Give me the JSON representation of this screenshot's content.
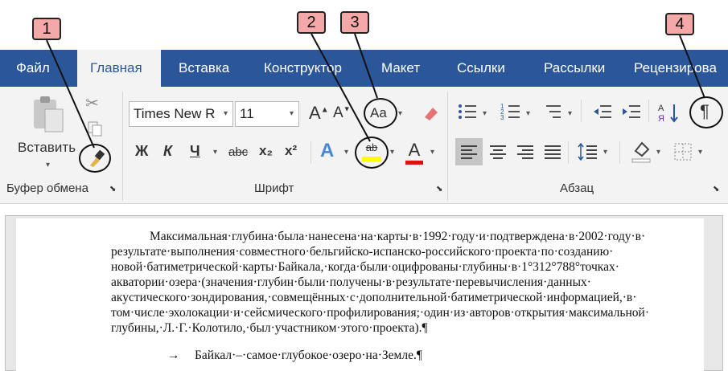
{
  "callouts": [
    "1",
    "2",
    "3",
    "4"
  ],
  "tabs": [
    "Файл",
    "Главная",
    "Вставка",
    "Конструктор",
    "Макет",
    "Ссылки",
    "Рассылки",
    "Рецензирова"
  ],
  "clipboard": {
    "paste_label": "Вставить",
    "group_label": "Буфер обмена"
  },
  "font": {
    "family_value": "Times New R",
    "size_value": "11",
    "group_label": "Шрифт",
    "change_case_label": "Aa",
    "bold": "Ж",
    "italic": "К",
    "underline": "Ч",
    "strike": "abc",
    "subscript": "x₂",
    "superscript": "x²",
    "effects": "A",
    "highlight": "ab",
    "color": "A"
  },
  "paragraph": {
    "group_label": "Абзац",
    "show_marks": "¶"
  },
  "document": {
    "paragraph_lines": [
      "Максимальная·глубина·была·нанесена·на·карты·в·1992·году·и·подтверждена·в·2002·году·в·",
      "результате·выполнения·совместного·бельгийско-испанско-российского·проекта·по·созданию·",
      "новой·батиметрической·карты·Байкала,·когда·были·оцифрованы·глубины·в·1°312°788°точках·",
      "акватории·озера·(значения·глубин·были·получены·в·результате·перевычисления·данных·",
      "акустического·зондирования,·совмещённых·с·дополнительной·батиметрической·информацией,·в·",
      "том·числе·эхолокации·и·сейсмического·профилирования;·один·из·авторов·открытия·максимальной·",
      "глубины,·Л.·Г.·Колотило,·был·участником·этого·проекта).¶"
    ],
    "tab_arrow": "→",
    "second_paragraph": "Байкал·–·самое·глубокое·озеро·на·Земле.¶"
  },
  "colors": {
    "tab_blue": "#2b579a",
    "highlight_yellow": "#ffff00",
    "font_red": "#e01010",
    "callout_pink": "#f4a8a8"
  }
}
